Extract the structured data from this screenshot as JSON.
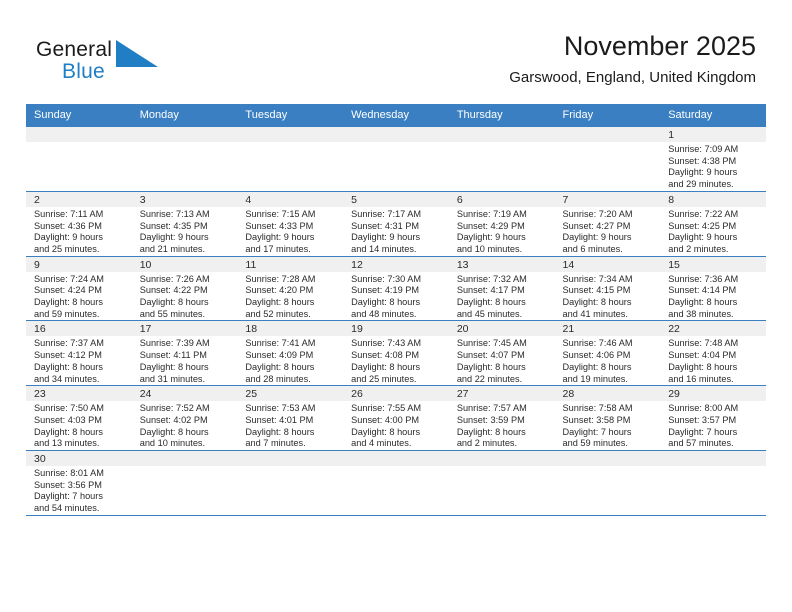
{
  "brand": {
    "name_top": "General",
    "name_bottom": "Blue",
    "flag_icon": "blue-triangle-flag-icon",
    "color_black": "#1b1b1b",
    "color_blue": "#1f7ec4"
  },
  "header": {
    "title": "November 2025",
    "subtitle": "Garswood, England, United Kingdom"
  },
  "theme": {
    "header_row_bg": "#3a7fc1",
    "daynum_bg": "#f0f0f0",
    "grid_line": "#3a7fc1",
    "text": "#2b2b2b"
  },
  "calendar": {
    "weekday_headers": [
      "Sunday",
      "Monday",
      "Tuesday",
      "Wednesday",
      "Thursday",
      "Friday",
      "Saturday"
    ],
    "labels": {
      "sunrise": "Sunrise:",
      "sunset": "Sunset:",
      "daylight": "Daylight:"
    },
    "weeks": [
      [
        {
          "empty": true
        },
        {
          "empty": true
        },
        {
          "empty": true
        },
        {
          "empty": true
        },
        {
          "empty": true
        },
        {
          "empty": true
        },
        {
          "day": "1",
          "sunrise": "Sunrise: 7:09 AM",
          "sunset": "Sunset: 4:38 PM",
          "daylight_line1": "Daylight: 9 hours",
          "daylight_line2": "and 29 minutes."
        }
      ],
      [
        {
          "day": "2",
          "sunrise": "Sunrise: 7:11 AM",
          "sunset": "Sunset: 4:36 PM",
          "daylight_line1": "Daylight: 9 hours",
          "daylight_line2": "and 25 minutes."
        },
        {
          "day": "3",
          "sunrise": "Sunrise: 7:13 AM",
          "sunset": "Sunset: 4:35 PM",
          "daylight_line1": "Daylight: 9 hours",
          "daylight_line2": "and 21 minutes."
        },
        {
          "day": "4",
          "sunrise": "Sunrise: 7:15 AM",
          "sunset": "Sunset: 4:33 PM",
          "daylight_line1": "Daylight: 9 hours",
          "daylight_line2": "and 17 minutes."
        },
        {
          "day": "5",
          "sunrise": "Sunrise: 7:17 AM",
          "sunset": "Sunset: 4:31 PM",
          "daylight_line1": "Daylight: 9 hours",
          "daylight_line2": "and 14 minutes."
        },
        {
          "day": "6",
          "sunrise": "Sunrise: 7:19 AM",
          "sunset": "Sunset: 4:29 PM",
          "daylight_line1": "Daylight: 9 hours",
          "daylight_line2": "and 10 minutes."
        },
        {
          "day": "7",
          "sunrise": "Sunrise: 7:20 AM",
          "sunset": "Sunset: 4:27 PM",
          "daylight_line1": "Daylight: 9 hours",
          "daylight_line2": "and 6 minutes."
        },
        {
          "day": "8",
          "sunrise": "Sunrise: 7:22 AM",
          "sunset": "Sunset: 4:25 PM",
          "daylight_line1": "Daylight: 9 hours",
          "daylight_line2": "and 2 minutes."
        }
      ],
      [
        {
          "day": "9",
          "sunrise": "Sunrise: 7:24 AM",
          "sunset": "Sunset: 4:24 PM",
          "daylight_line1": "Daylight: 8 hours",
          "daylight_line2": "and 59 minutes."
        },
        {
          "day": "10",
          "sunrise": "Sunrise: 7:26 AM",
          "sunset": "Sunset: 4:22 PM",
          "daylight_line1": "Daylight: 8 hours",
          "daylight_line2": "and 55 minutes."
        },
        {
          "day": "11",
          "sunrise": "Sunrise: 7:28 AM",
          "sunset": "Sunset: 4:20 PM",
          "daylight_line1": "Daylight: 8 hours",
          "daylight_line2": "and 52 minutes."
        },
        {
          "day": "12",
          "sunrise": "Sunrise: 7:30 AM",
          "sunset": "Sunset: 4:19 PM",
          "daylight_line1": "Daylight: 8 hours",
          "daylight_line2": "and 48 minutes."
        },
        {
          "day": "13",
          "sunrise": "Sunrise: 7:32 AM",
          "sunset": "Sunset: 4:17 PM",
          "daylight_line1": "Daylight: 8 hours",
          "daylight_line2": "and 45 minutes."
        },
        {
          "day": "14",
          "sunrise": "Sunrise: 7:34 AM",
          "sunset": "Sunset: 4:15 PM",
          "daylight_line1": "Daylight: 8 hours",
          "daylight_line2": "and 41 minutes."
        },
        {
          "day": "15",
          "sunrise": "Sunrise: 7:36 AM",
          "sunset": "Sunset: 4:14 PM",
          "daylight_line1": "Daylight: 8 hours",
          "daylight_line2": "and 38 minutes."
        }
      ],
      [
        {
          "day": "16",
          "sunrise": "Sunrise: 7:37 AM",
          "sunset": "Sunset: 4:12 PM",
          "daylight_line1": "Daylight: 8 hours",
          "daylight_line2": "and 34 minutes."
        },
        {
          "day": "17",
          "sunrise": "Sunrise: 7:39 AM",
          "sunset": "Sunset: 4:11 PM",
          "daylight_line1": "Daylight: 8 hours",
          "daylight_line2": "and 31 minutes."
        },
        {
          "day": "18",
          "sunrise": "Sunrise: 7:41 AM",
          "sunset": "Sunset: 4:09 PM",
          "daylight_line1": "Daylight: 8 hours",
          "daylight_line2": "and 28 minutes."
        },
        {
          "day": "19",
          "sunrise": "Sunrise: 7:43 AM",
          "sunset": "Sunset: 4:08 PM",
          "daylight_line1": "Daylight: 8 hours",
          "daylight_line2": "and 25 minutes."
        },
        {
          "day": "20",
          "sunrise": "Sunrise: 7:45 AM",
          "sunset": "Sunset: 4:07 PM",
          "daylight_line1": "Daylight: 8 hours",
          "daylight_line2": "and 22 minutes."
        },
        {
          "day": "21",
          "sunrise": "Sunrise: 7:46 AM",
          "sunset": "Sunset: 4:06 PM",
          "daylight_line1": "Daylight: 8 hours",
          "daylight_line2": "and 19 minutes."
        },
        {
          "day": "22",
          "sunrise": "Sunrise: 7:48 AM",
          "sunset": "Sunset: 4:04 PM",
          "daylight_line1": "Daylight: 8 hours",
          "daylight_line2": "and 16 minutes."
        }
      ],
      [
        {
          "day": "23",
          "sunrise": "Sunrise: 7:50 AM",
          "sunset": "Sunset: 4:03 PM",
          "daylight_line1": "Daylight: 8 hours",
          "daylight_line2": "and 13 minutes."
        },
        {
          "day": "24",
          "sunrise": "Sunrise: 7:52 AM",
          "sunset": "Sunset: 4:02 PM",
          "daylight_line1": "Daylight: 8 hours",
          "daylight_line2": "and 10 minutes."
        },
        {
          "day": "25",
          "sunrise": "Sunrise: 7:53 AM",
          "sunset": "Sunset: 4:01 PM",
          "daylight_line1": "Daylight: 8 hours",
          "daylight_line2": "and 7 minutes."
        },
        {
          "day": "26",
          "sunrise": "Sunrise: 7:55 AM",
          "sunset": "Sunset: 4:00 PM",
          "daylight_line1": "Daylight: 8 hours",
          "daylight_line2": "and 4 minutes."
        },
        {
          "day": "27",
          "sunrise": "Sunrise: 7:57 AM",
          "sunset": "Sunset: 3:59 PM",
          "daylight_line1": "Daylight: 8 hours",
          "daylight_line2": "and 2 minutes."
        },
        {
          "day": "28",
          "sunrise": "Sunrise: 7:58 AM",
          "sunset": "Sunset: 3:58 PM",
          "daylight_line1": "Daylight: 7 hours",
          "daylight_line2": "and 59 minutes."
        },
        {
          "day": "29",
          "sunrise": "Sunrise: 8:00 AM",
          "sunset": "Sunset: 3:57 PM",
          "daylight_line1": "Daylight: 7 hours",
          "daylight_line2": "and 57 minutes."
        }
      ],
      [
        {
          "day": "30",
          "sunrise": "Sunrise: 8:01 AM",
          "sunset": "Sunset: 3:56 PM",
          "daylight_line1": "Daylight: 7 hours",
          "daylight_line2": "and 54 minutes."
        },
        {
          "empty": true
        },
        {
          "empty": true
        },
        {
          "empty": true
        },
        {
          "empty": true
        },
        {
          "empty": true
        },
        {
          "empty": true
        }
      ]
    ]
  }
}
